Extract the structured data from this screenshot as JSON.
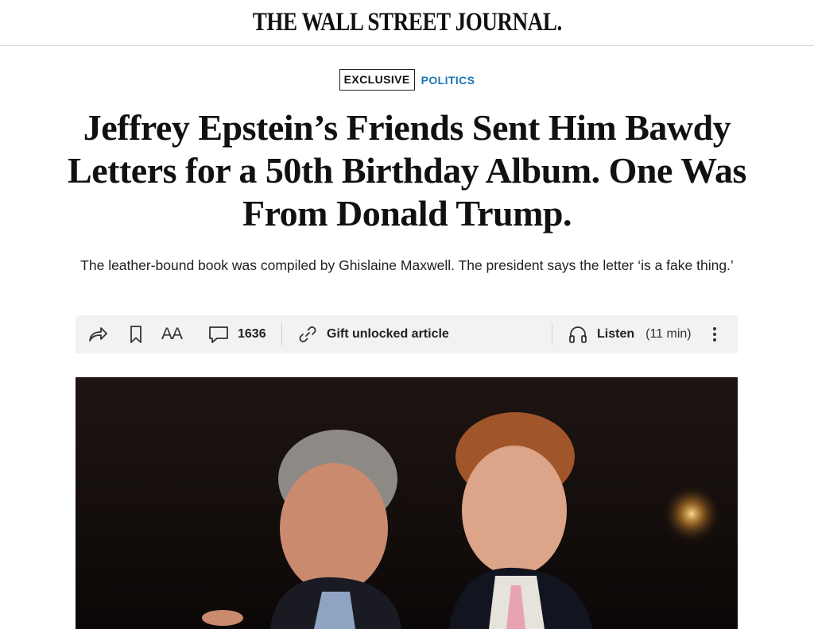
{
  "masthead": {
    "title": "THE WALL STREET JOURNAL."
  },
  "labels": {
    "exclusive": "EXCLUSIVE",
    "section": "POLITICS"
  },
  "article": {
    "headline": "Jeffrey Epstein’s Friends Sent Him Bawdy Letters for a 50th Birthday Album. One Was From Donald Trump.",
    "dek": "The leather-bound book was compiled by Ghislaine Maxwell. The president says the letter ‘is a fake thing.’"
  },
  "toolbar": {
    "share_icon": "share-icon",
    "bookmark_icon": "bookmark-icon",
    "text_size_label": "AA",
    "comments_icon": "comment-icon",
    "comments_count": "1636",
    "gift_icon": "link-icon",
    "gift_label": "Gift unlocked article",
    "listen_icon": "headphones-icon",
    "listen_label": "Listen",
    "listen_duration": "(11 min)",
    "more_icon": "more-vertical-icon"
  },
  "colors": {
    "section_label": "#1b76b8",
    "toolbar_bg": "#f2f2f2",
    "text": "#111111"
  },
  "hero_image": {
    "subject": "photo of two men in suits smiling"
  }
}
